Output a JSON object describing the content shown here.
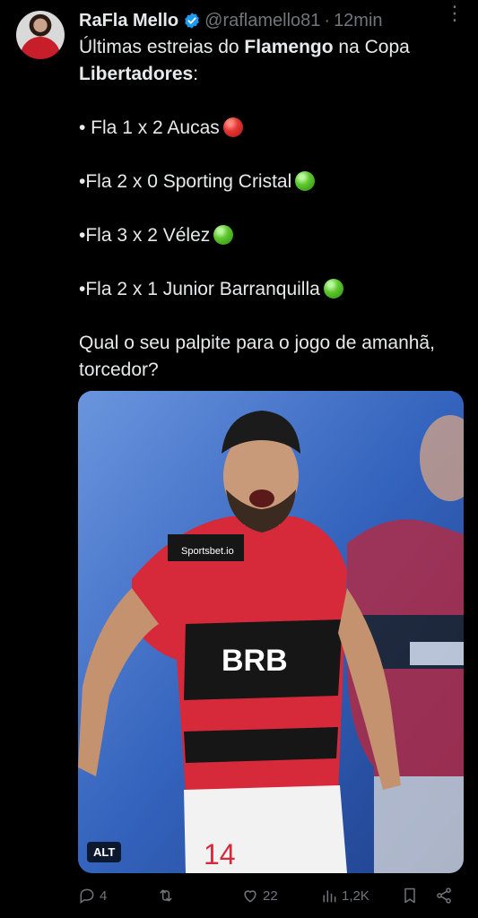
{
  "author": {
    "name": "RaFla Mello",
    "handle": "@raflamello81",
    "time": "12min",
    "separator": "·"
  },
  "tweet": {
    "intro_1": "Últimas estreias do ",
    "intro_bold_1": "Flamengo",
    "intro_2": " na Copa ",
    "intro_bold_2": "Libertadores",
    "intro_3": ":",
    "results": [
      {
        "text": "• Fla 1 x 2 Aucas",
        "emoji": "red-ball-emoji"
      },
      {
        "text": "•Fla 2 x 0 Sporting Cristal",
        "emoji": "green-ball-emoji"
      },
      {
        "text": "•Fla 3 x 2 Vélez",
        "emoji": "green-ball-emoji"
      },
      {
        "text": "•Fla 2 x 1 Junior Barranquilla",
        "emoji": "green-ball-emoji"
      }
    ],
    "question": "Qual o seu palpite para o jogo de amanhã, torcedor?"
  },
  "media": {
    "alt_label": "ALT",
    "shirt_sponsor": "BRB",
    "shirt_brand": "Sportsbet.io",
    "shirt_number": "14"
  },
  "actions": {
    "replies": "4",
    "retweets": "",
    "likes": "22",
    "views": "1,2K"
  },
  "colors": {
    "background": "#000000",
    "text": "#e7e9ea",
    "muted": "#71767b",
    "verified": "#1d9bf0"
  }
}
